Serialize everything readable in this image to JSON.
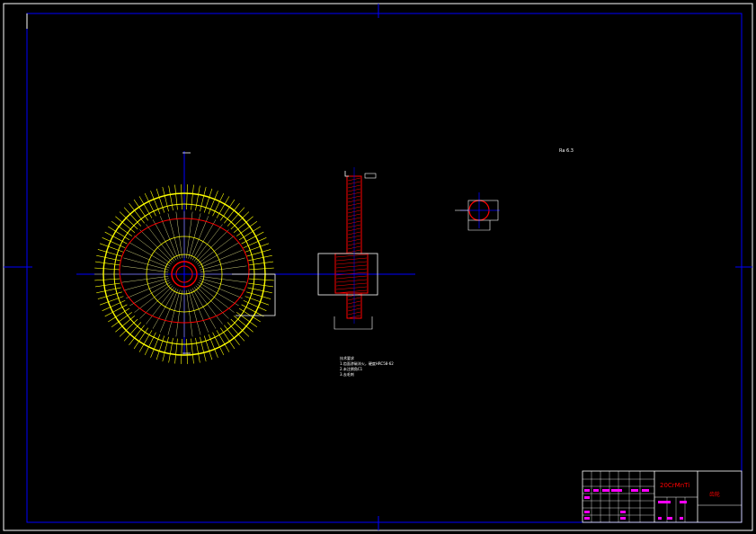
{
  "drawing": {
    "material": "20CrMnTi",
    "part_name": "齿轮",
    "scale_note": "1:1"
  },
  "technical_requirements": {
    "heading": "技术要求",
    "lines": [
      "1.齿面渗碳淬火，硬度HRC58-62",
      "2.未注倒角C1",
      "3.去毛刺"
    ]
  },
  "roughness_symbol": "Ra 6.3",
  "colors": {
    "background": "#000000",
    "frame": "#0000ff",
    "outer_frame": "#ffffff",
    "center_line": "#0000ff",
    "tooth": "#ffff00",
    "pitch_circle": "#ff0000",
    "hatch": "#ff0000",
    "title_text_red": "#ff0000",
    "title_text_magenta": "#ff00ff",
    "dimension": "#ffffff"
  }
}
